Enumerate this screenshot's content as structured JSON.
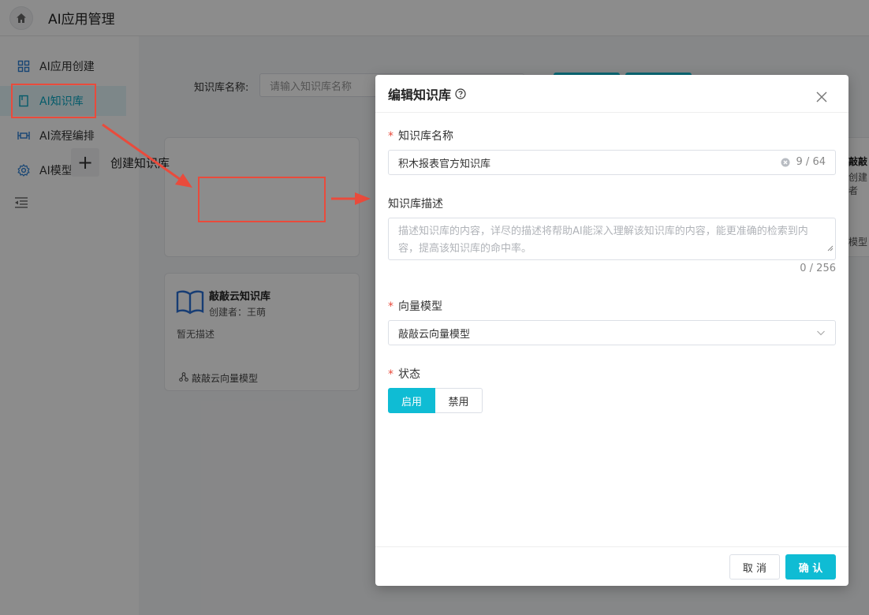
{
  "app": {
    "title": "AI应用管理"
  },
  "sidebar": {
    "items": [
      {
        "label": "AI应用创建",
        "icon": "grid-icon"
      },
      {
        "label": "AI知识库",
        "icon": "book-icon",
        "active": true
      },
      {
        "label": "AI流程编排",
        "icon": "flow-icon"
      },
      {
        "label": "AI模型管理",
        "icon": "gear-icon"
      }
    ]
  },
  "search": {
    "label": "知识库名称:",
    "placeholder": "请输入知识库名称"
  },
  "create_card": {
    "label": "创建知识库"
  },
  "kb_card": {
    "title": "敲敲云知识库",
    "creator": "创建者：王萌",
    "description": "暂无描述",
    "model": "敲敲云向量模型"
  },
  "peek_card": {
    "title": "敲敲",
    "creator": "创建者",
    "desc": "述",
    "model": "模型"
  },
  "dialog": {
    "title": "编辑知识库",
    "name_label": "知识库名称",
    "name_value": "积木报表官方知识库",
    "name_count": "9 / 64",
    "desc_label": "知识库描述",
    "desc_placeholder": "描述知识库的内容，详尽的描述将帮助AI能深入理解该知识库的内容，能更准确的检索到内容，提高该知识库的命中率。",
    "desc_count": "0 / 256",
    "model_label": "向量模型",
    "model_value": "敲敲云向量模型",
    "status_label": "状态",
    "status_on": "启用",
    "status_off": "禁用",
    "cancel": "取 消",
    "confirm": "确 认"
  },
  "colors": {
    "accent": "#0fbcd4",
    "annotation": "#e94b3c"
  }
}
